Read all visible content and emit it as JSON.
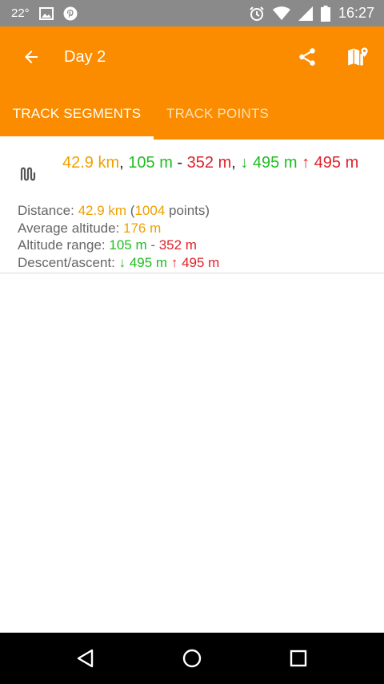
{
  "status_bar": {
    "temperature": "22°",
    "time": "16:27"
  },
  "toolbar": {
    "title": "Day 2"
  },
  "tabs": [
    {
      "label": "TRACK SEGMENTS"
    },
    {
      "label": "TRACK POINTS"
    }
  ],
  "segment": {
    "title": {
      "distance": "42.9 km",
      "sep1": ",",
      "min_alt": "105 m",
      "dash": " - ",
      "max_alt": "352 m",
      "sep2": ",",
      "descent": "↓ 495 m",
      "ascent": "↑ 495 m"
    },
    "details": {
      "distance_label": "Distance: ",
      "distance_value": "42.9 km",
      "points_open": " (",
      "points_count": "1004",
      "points_label": " points)",
      "avg_alt_label": "Average altitude: ",
      "avg_alt_value": "176 m",
      "range_label": "Altitude range: ",
      "range_min": "105 m",
      "range_dash": " - ",
      "range_max": "352 m",
      "descent_label": "Descent/ascent: ",
      "descent_value": "↓ 495 m",
      "ascent_value": "↑ 495 m"
    }
  },
  "colors": {
    "accent": "#fb8c00",
    "distance": "#f0a000",
    "min": "#1fbd1f",
    "max": "#e0202a"
  }
}
